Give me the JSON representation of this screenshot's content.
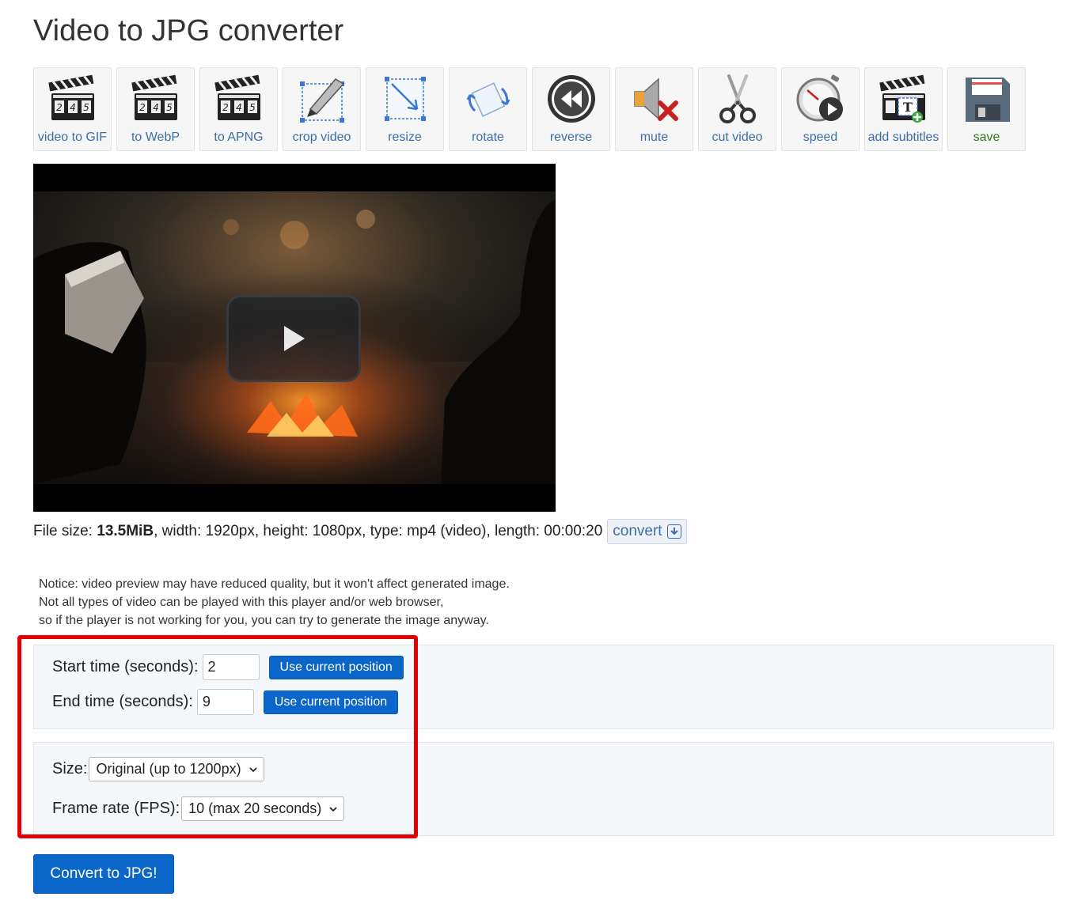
{
  "page": {
    "title": "Video to JPG converter"
  },
  "toolbar": {
    "items": [
      {
        "label": "video to GIF",
        "icon": "clapperboard-icon"
      },
      {
        "label": "to WebP",
        "icon": "clapperboard-icon"
      },
      {
        "label": "to APNG",
        "icon": "clapperboard-icon"
      },
      {
        "label": "crop video",
        "icon": "crop-icon"
      },
      {
        "label": "resize",
        "icon": "resize-icon"
      },
      {
        "label": "rotate",
        "icon": "rotate-icon"
      },
      {
        "label": "reverse",
        "icon": "rewind-icon"
      },
      {
        "label": "mute",
        "icon": "mute-icon"
      },
      {
        "label": "cut video",
        "icon": "scissors-icon"
      },
      {
        "label": "speed",
        "icon": "stopwatch-icon"
      },
      {
        "label": "add subtitles",
        "icon": "subtitles-icon"
      },
      {
        "label": "save",
        "icon": "floppy-disk-icon"
      }
    ],
    "clapper_digits": "2 4 5"
  },
  "video": {
    "play_icon": "play-icon"
  },
  "fileinfo": {
    "size_label": "File size:",
    "size_value": "13.5MiB",
    "rest": ", width: 1920px, height: 1080px, type: mp4 (video), length: 00:00:20",
    "convert_label": "convert"
  },
  "notice": {
    "line1": "Notice: video preview may have reduced quality, but it won't affect generated image.",
    "line2": "Not all types of video can be played with this player and/or web browser,",
    "line3": "so if the player is not working for you, you can try to generate the image anyway."
  },
  "form": {
    "start_label": "Start time (seconds):",
    "start_value": "2",
    "end_label": "End time (seconds):",
    "end_value": "9",
    "use_current_label": "Use current position",
    "size_label": "Size:",
    "size_selected": "Original (up to 1200px)",
    "fps_label": "Frame rate (FPS):",
    "fps_selected": "10 (max 20 seconds)",
    "submit_label": "Convert to JPG!"
  },
  "colors": {
    "primary": "#0b66c9",
    "link": "#3b6ea8",
    "save": "#2f7a1f",
    "highlight": "#e30000"
  }
}
